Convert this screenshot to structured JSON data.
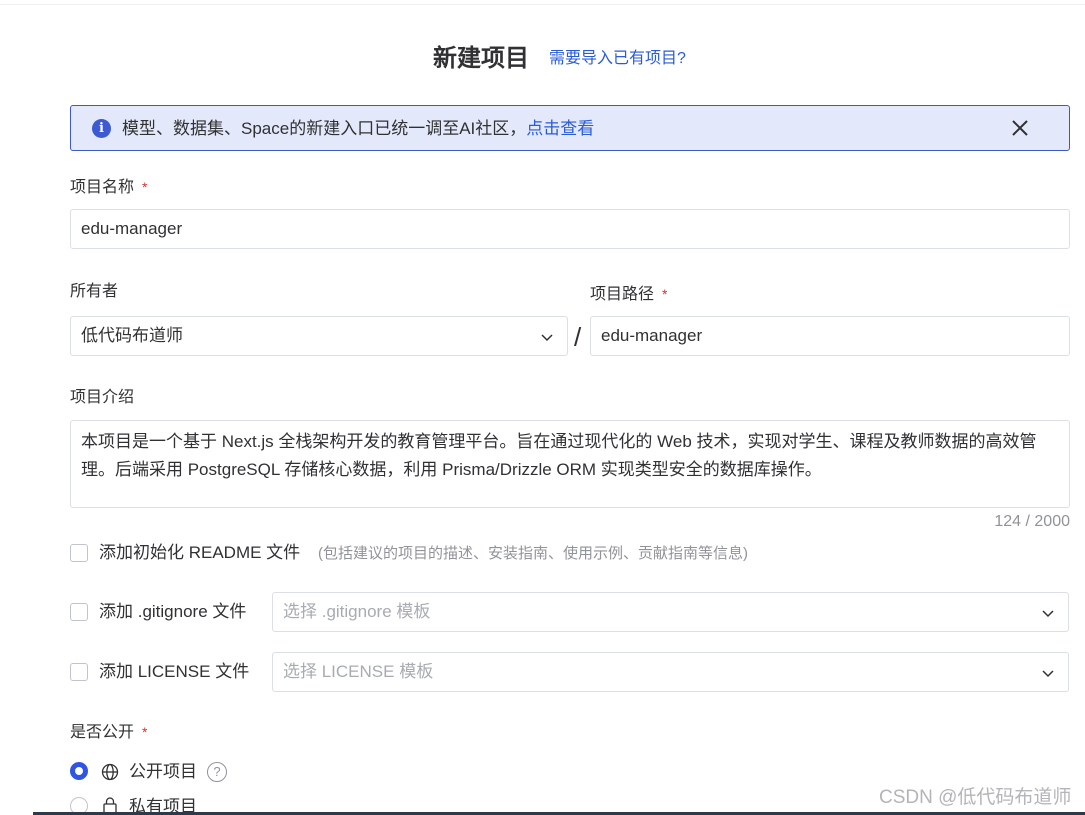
{
  "header": {
    "title": "新建项目",
    "import_link": "需要导入已有项目?"
  },
  "notice": {
    "message": "模型、数据集、Space的新建入口已统一调至AI社区，",
    "link": "点击查看"
  },
  "project_name": {
    "label": "项目名称",
    "required_mark": "*",
    "value": "edu-manager"
  },
  "owner": {
    "label": "所有者",
    "value": "低代码布道师"
  },
  "separator": "/",
  "project_path": {
    "label": "项目路径",
    "required_mark": "*",
    "value": "edu-manager"
  },
  "description": {
    "label": "项目介绍",
    "value": "本项目是一个基于 Next.js 全栈架构开发的教育管理平台。旨在通过现代化的 Web 技术，实现对学生、课程及教师数据的高效管理。后端采用 PostgreSQL 存储核心数据，利用 Prisma/Drizzle ORM 实现类型安全的数据库操作。",
    "counter": "124 / 2000"
  },
  "readme": {
    "label": "添加初始化 README 文件",
    "hint": "(包括建议的项目的描述、安装指南、使用示例、贡献指南等信息)",
    "checked": false
  },
  "gitignore": {
    "label": "添加 .gitignore 文件",
    "placeholder": "选择 .gitignore 模板",
    "checked": false
  },
  "license": {
    "label": "添加 LICENSE 文件",
    "placeholder": "选择 LICENSE 模板",
    "checked": false
  },
  "visibility": {
    "label": "是否公开",
    "required_mark": "*",
    "options": [
      {
        "label": "公开项目",
        "icon": "globe-icon",
        "selected": true
      },
      {
        "label": "私有项目",
        "icon": "lock-icon",
        "selected": false
      }
    ],
    "help": "?"
  },
  "watermark": "CSDN @低代码布道师",
  "colors": {
    "primary": "#2f55e4",
    "link": "#2a5bd7",
    "notice_bg": "#e3e8fb",
    "required": "#d9312e"
  }
}
